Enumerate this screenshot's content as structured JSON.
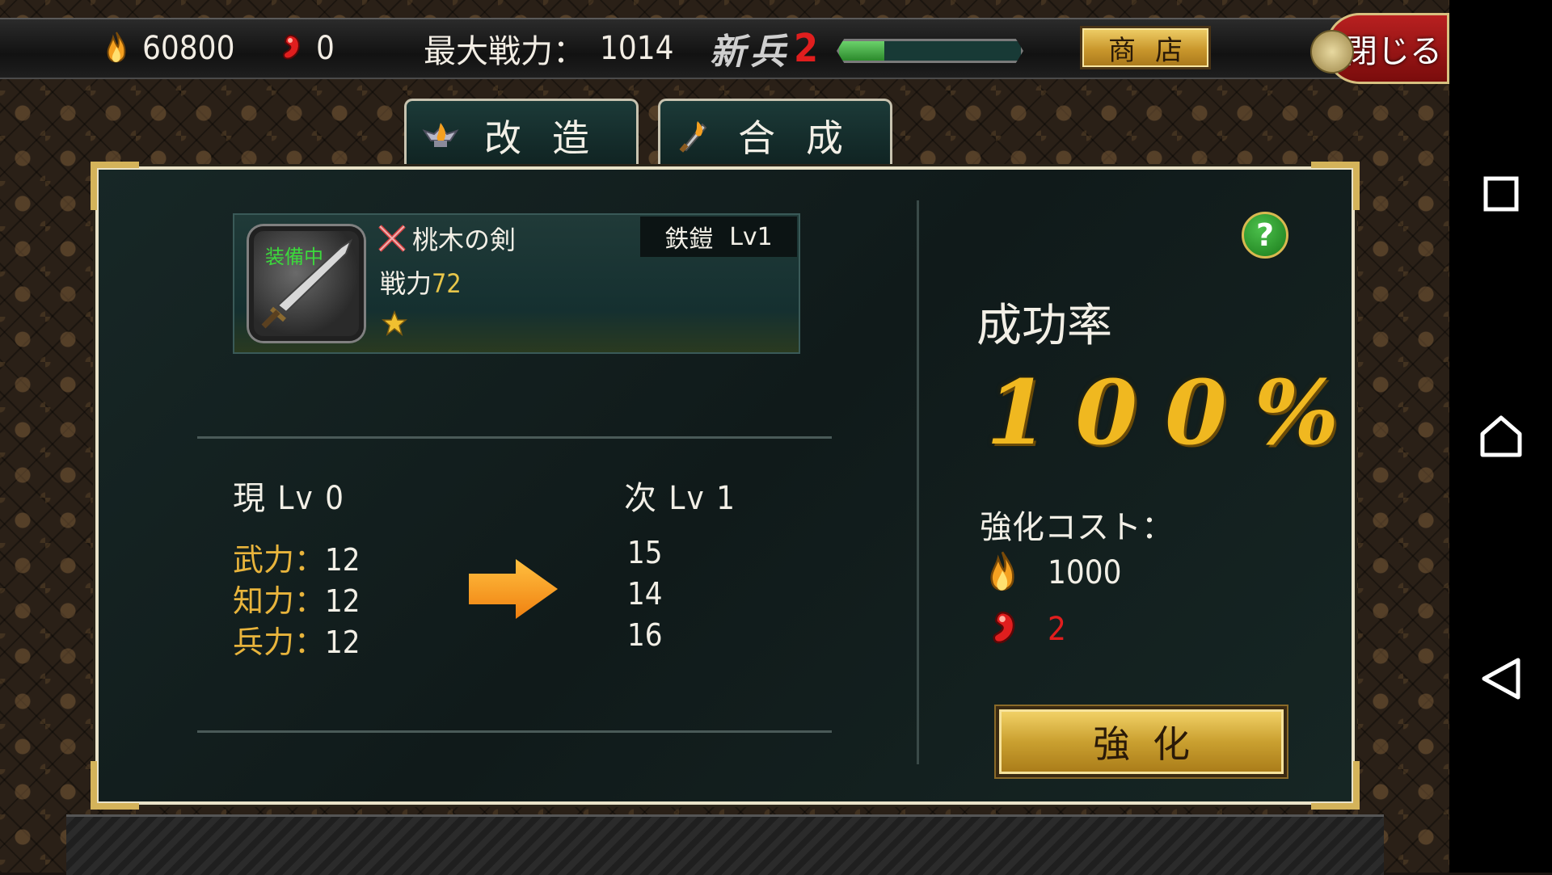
{
  "header": {
    "gold_value": "60800",
    "gem_value": "0",
    "max_power_label": "最大戦力：",
    "max_power_value": "1014",
    "rank_label": "新兵",
    "rank_level": "2",
    "rank_progress": 0.25,
    "shop_label": "商店",
    "close_label": "閉じる"
  },
  "tabs": [
    {
      "label": "改造",
      "icon": "fire-trophy-icon"
    },
    {
      "label": "合成",
      "icon": "fire-sword-icon"
    }
  ],
  "item": {
    "equipped_label": "装備中",
    "name": "桃木の剣",
    "power_label": "戦力",
    "power_value": "72",
    "stars": 1,
    "armor_label": "鉄鎧",
    "armor_level": "Lv1"
  },
  "levels": {
    "current_label": "現 Lv 0",
    "next_label": "次 Lv 1"
  },
  "stats": [
    {
      "name": "武力",
      "current": "12",
      "next": "15"
    },
    {
      "name": "知力",
      "current": "12",
      "next": "14"
    },
    {
      "name": "兵力",
      "current": "12",
      "next": "16"
    }
  ],
  "success": {
    "label": "成功率",
    "value": "100%"
  },
  "cost": {
    "label": "強化コスト：",
    "gold": "1000",
    "gem": "2"
  },
  "enhance_label": "強化",
  "colors": {
    "accent_gold": "#f0b820",
    "stat_label": "#e8b43c",
    "gem_red": "#e01e1e",
    "equipped_green": "#3cd83c"
  }
}
